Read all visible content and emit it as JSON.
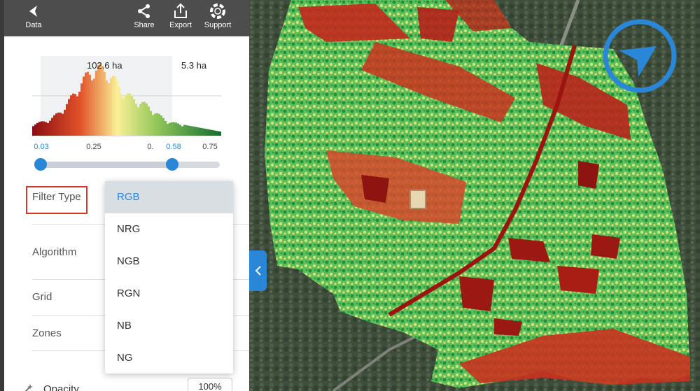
{
  "toolbar": {
    "back_label": "Data",
    "share_label": "Share",
    "export_label": "Export",
    "support_label": "Support"
  },
  "histogram": {
    "area_left": "102.6 ha",
    "area_right": "5.3 ha",
    "ticks": [
      "0.03",
      "0.25",
      "0.",
      "0.58",
      "0.75"
    ],
    "range_min": 0.03,
    "range_max": 0.58
  },
  "settings": {
    "filter_type_label": "Filter Type",
    "algorithm_label": "Algorithm",
    "grid_label": "Grid",
    "zones_label": "Zones",
    "opacity_label": "Opacity",
    "opacity_value": "100%"
  },
  "filter_dropdown": {
    "options": [
      "RGB",
      "NRG",
      "NGB",
      "RGN",
      "NB",
      "NG"
    ],
    "selected": "RGB"
  },
  "colors": {
    "accent": "#2a87d8",
    "toolbar_bg": "#4d4d4d",
    "highlight_box": "#d8352f"
  },
  "icons": {
    "back": "chevron-left-icon",
    "share": "share-icon",
    "export": "export-icon",
    "support": "lifebuoy-icon",
    "collapse": "chevron-left-icon",
    "compass": "compass-arrow-icon"
  }
}
